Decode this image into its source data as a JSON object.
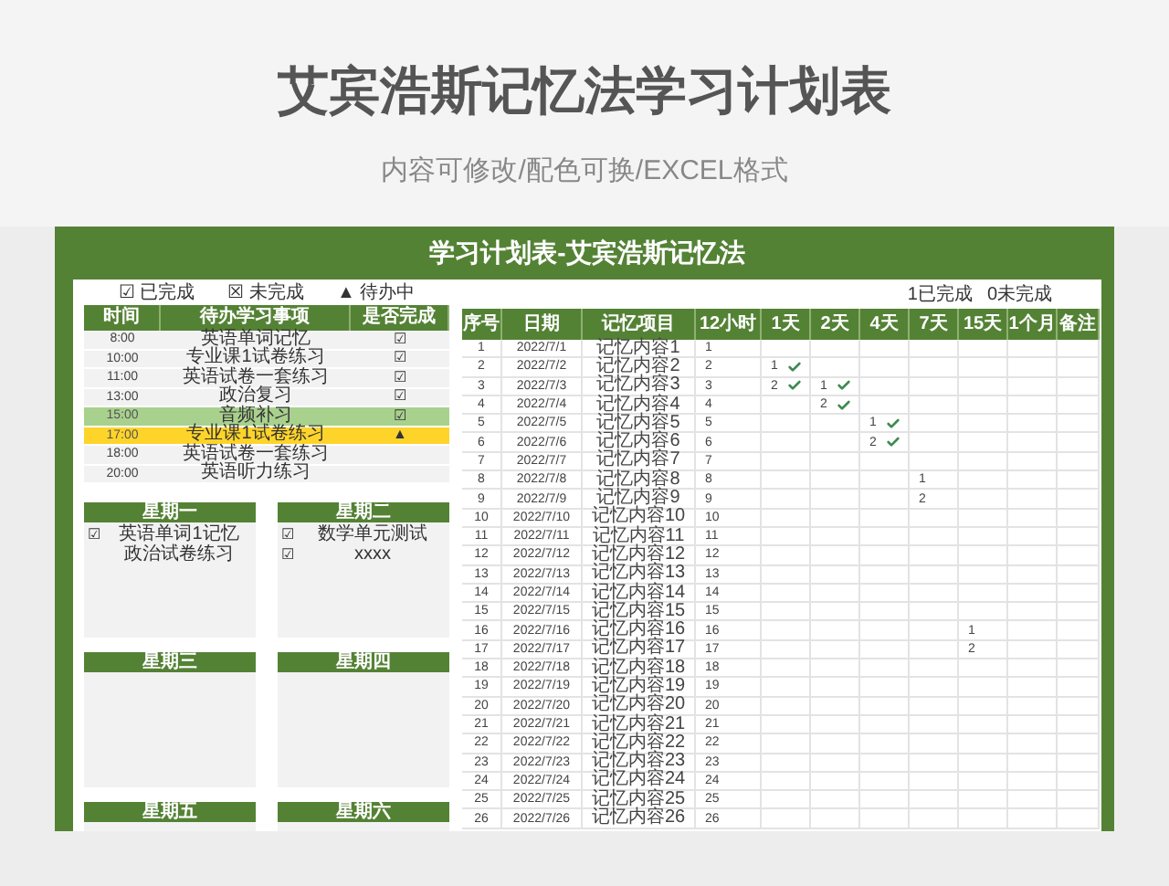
{
  "header": {
    "title": "艾宾浩斯记忆法学习计划表",
    "subtitle": "内容可修改/配色可换/EXCEL格式"
  },
  "sheet": {
    "title": "学习计划表-艾宾浩斯记忆法",
    "legend": [
      {
        "symbol": "☑",
        "label": "已完成"
      },
      {
        "symbol": "☒",
        "label": "未完成"
      },
      {
        "symbol": "▲",
        "label": "待办中"
      }
    ],
    "todo": {
      "columns": [
        "时间",
        "待办学习事项",
        "是否完成"
      ],
      "rows": [
        {
          "time": "8:00",
          "task": "英语单词记忆",
          "mark": "☑"
        },
        {
          "time": "10:00",
          "task": "专业课1试卷练习",
          "mark": "☑"
        },
        {
          "time": "11:00",
          "task": "英语试卷一套练习",
          "mark": "☑"
        },
        {
          "time": "13:00",
          "task": "政治复习",
          "mark": "☑"
        },
        {
          "time": "15:00",
          "task": "音频补习",
          "mark": "☑",
          "color": "#a9d18e"
        },
        {
          "time": "17:00",
          "task": "专业课1试卷练习",
          "mark": "▲",
          "color": "#ffd42a"
        },
        {
          "time": "18:00",
          "task": "英语试卷一套练习"
        },
        {
          "time": "20:00",
          "task": "英语听力练习"
        }
      ]
    },
    "week": [
      {
        "day": "星期一",
        "items": [
          {
            "mark": "☑",
            "text": "英语单词1记忆"
          },
          {
            "text": "政治试卷练习"
          }
        ]
      },
      {
        "day": "星期二",
        "items": [
          {
            "mark": "☑",
            "text": "数学单元测试"
          },
          {
            "mark": "☑",
            "text": "xxxx"
          }
        ]
      },
      {
        "day": "星期三"
      },
      {
        "day": "星期四"
      },
      {
        "day": "星期五"
      },
      {
        "day": "星期六"
      }
    ],
    "summary": [
      "1已完成",
      "0未完成"
    ],
    "review": {
      "columns": [
        "序号",
        "日期",
        "记忆项目",
        "12小时",
        "1天",
        "2天",
        "4天",
        "7天",
        "15天",
        "1个月",
        "备注"
      ],
      "rows": [
        {
          "no": "1",
          "date": "2022/7/1",
          "item": "记忆内容1",
          "hours": "1"
        },
        {
          "no": "2",
          "date": "2022/7/2",
          "item": "记忆内容2",
          "hours": "2",
          "reviews": [
            {
              "kind": "review",
              "text": "1",
              "checked": true
            },
            {
              "kind": "blank"
            },
            {
              "kind": "blank"
            },
            {
              "kind": "blank"
            },
            {
              "kind": "blank"
            },
            {
              "kind": "blank"
            },
            {
              "kind": "blank"
            }
          ]
        },
        {
          "no": "3",
          "date": "2022/7/3",
          "item": "记忆内容3",
          "hours": "3",
          "reviews": [
            {
              "kind": "review",
              "text": "2",
              "checked": true
            },
            {
              "kind": "review",
              "text": "1",
              "checked": true
            },
            {
              "kind": "blank"
            },
            {
              "kind": "blank"
            },
            {
              "kind": "blank"
            },
            {
              "kind": "blank"
            },
            {
              "kind": "blank"
            }
          ]
        },
        {
          "no": "4",
          "date": "2022/7/4",
          "item": "记忆内容4",
          "hours": "4",
          "reviews": [
            {
              "kind": "blank"
            },
            {
              "kind": "review",
              "text": "2",
              "checked": true
            },
            {
              "kind": "blank"
            },
            {
              "kind": "blank"
            },
            {
              "kind": "blank"
            },
            {
              "kind": "blank"
            },
            {
              "kind": "blank"
            }
          ]
        },
        {
          "no": "5",
          "date": "2022/7/5",
          "item": "记忆内容5",
          "hours": "5",
          "reviews": [
            {
              "kind": "blank"
            },
            {
              "kind": "blank"
            },
            {
              "kind": "review",
              "text": "1",
              "checked": true
            },
            {
              "kind": "blank"
            },
            {
              "kind": "blank"
            },
            {
              "kind": "blank"
            },
            {
              "kind": "blank"
            }
          ]
        },
        {
          "no": "6",
          "date": "2022/7/6",
          "item": "记忆内容6",
          "hours": "6",
          "reviews": [
            {
              "kind": "blank"
            },
            {
              "kind": "blank"
            },
            {
              "kind": "review",
              "text": "2",
              "checked": true
            },
            {
              "kind": "blank"
            },
            {
              "kind": "blank"
            },
            {
              "kind": "blank"
            },
            {
              "kind": "blank"
            }
          ]
        },
        {
          "no": "7",
          "date": "2022/7/7",
          "item": "记忆内容7",
          "hours": "7"
        },
        {
          "no": "8",
          "date": "2022/7/8",
          "item": "记忆内容8",
          "hours": "8",
          "reviews": [
            {
              "kind": "blank"
            },
            {
              "kind": "blank"
            },
            {
              "kind": "blank"
            },
            {
              "kind": "review",
              "text": "1",
              "checked": false
            },
            {
              "kind": "blank"
            },
            {
              "kind": "blank"
            },
            {
              "kind": "blank"
            }
          ]
        },
        {
          "no": "9",
          "date": "2022/7/9",
          "item": "记忆内容9",
          "hours": "9",
          "reviews": [
            {
              "kind": "blank"
            },
            {
              "kind": "blank"
            },
            {
              "kind": "blank"
            },
            {
              "kind": "review",
              "text": "2",
              "checked": false
            },
            {
              "kind": "blank"
            },
            {
              "kind": "blank"
            },
            {
              "kind": "blank"
            }
          ]
        },
        {
          "no": "10",
          "date": "2022/7/10",
          "item": "记忆内容10",
          "hours": "10"
        },
        {
          "no": "11",
          "date": "2022/7/11",
          "item": "记忆内容11",
          "hours": "11"
        },
        {
          "no": "12",
          "date": "2022/7/12",
          "item": "记忆内容12",
          "hours": "12"
        },
        {
          "no": "13",
          "date": "2022/7/13",
          "item": "记忆内容13",
          "hours": "13"
        },
        {
          "no": "14",
          "date": "2022/7/14",
          "item": "记忆内容14",
          "hours": "14"
        },
        {
          "no": "15",
          "date": "2022/7/15",
          "item": "记忆内容15",
          "hours": "15"
        },
        {
          "no": "16",
          "date": "2022/7/16",
          "item": "记忆内容16",
          "hours": "16",
          "reviews": [
            {
              "kind": "blank"
            },
            {
              "kind": "blank"
            },
            {
              "kind": "blank"
            },
            {
              "kind": "blank"
            },
            {
              "kind": "review",
              "text": "1",
              "checked": false
            },
            {
              "kind": "blank"
            },
            {
              "kind": "blank"
            }
          ]
        },
        {
          "no": "17",
          "date": "2022/7/17",
          "item": "记忆内容17",
          "hours": "17",
          "reviews": [
            {
              "kind": "blank"
            },
            {
              "kind": "blank"
            },
            {
              "kind": "blank"
            },
            {
              "kind": "blank"
            },
            {
              "kind": "review",
              "text": "2",
              "checked": false
            },
            {
              "kind": "blank"
            },
            {
              "kind": "blank"
            }
          ]
        },
        {
          "no": "18",
          "date": "2022/7/18",
          "item": "记忆内容18",
          "hours": "18"
        },
        {
          "no": "19",
          "date": "2022/7/19",
          "item": "记忆内容19",
          "hours": "19"
        },
        {
          "no": "20",
          "date": "2022/7/20",
          "item": "记忆内容20",
          "hours": "20"
        },
        {
          "no": "21",
          "date": "2022/7/21",
          "item": "记忆内容21",
          "hours": "21"
        },
        {
          "no": "22",
          "date": "2022/7/22",
          "item": "记忆内容22",
          "hours": "22"
        },
        {
          "no": "23",
          "date": "2022/7/23",
          "item": "记忆内容23",
          "hours": "23"
        },
        {
          "no": "24",
          "date": "2022/7/24",
          "item": "记忆内容24",
          "hours": "24"
        },
        {
          "no": "25",
          "date": "2022/7/25",
          "item": "记忆内容25",
          "hours": "25"
        },
        {
          "no": "26",
          "date": "2022/7/26",
          "item": "记忆内容26",
          "hours": "26"
        }
      ]
    }
  }
}
